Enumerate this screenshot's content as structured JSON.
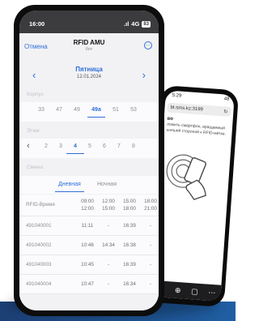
{
  "status_bar": {
    "time": "16:00",
    "network": "4G",
    "battery": "83"
  },
  "back_phone": {
    "time": "5:29",
    "battery": "48",
    "url": "bt.sms.kz:3199",
    "heading": "во",
    "text_lines": [
      "ложить смартфон, вращаемый",
      "ьняшей стороной к RFID-метке."
    ],
    "nav_icons": [
      "arrow-left-icon",
      "plus-icon",
      "tabs-icon",
      "more-icon"
    ]
  },
  "nav": {
    "cancel_label": "Отмена",
    "title": "RFID AMU",
    "subtitle": "бот",
    "more_icon": "ellipsis-circle-icon"
  },
  "day": {
    "name": "Пятница",
    "date": "12.01.2024"
  },
  "building": {
    "label": "Корпус",
    "options": [
      "33",
      "47",
      "49",
      "49a",
      "51",
      "53"
    ],
    "selected": "49a"
  },
  "floor": {
    "label": "Этаж",
    "options": [
      "2",
      "3",
      "4",
      "5",
      "6",
      "7",
      "8"
    ],
    "selected": "4"
  },
  "shift": {
    "label": "Смена",
    "tabs": [
      "Дневная",
      "Ночная"
    ],
    "selected": "Дневная"
  },
  "table": {
    "header_label": "RFID-Время",
    "columns": [
      {
        "start": "09:00",
        "end": "12:00"
      },
      {
        "start": "12:00",
        "end": "15:00"
      },
      {
        "start": "15:00",
        "end": "18:00"
      },
      {
        "start": "18:00",
        "end": "21:00"
      }
    ],
    "rows": [
      {
        "id": "491040001",
        "values": [
          "11:11",
          "-",
          "16:39",
          "-"
        ]
      },
      {
        "id": "491040002",
        "values": [
          "10:46",
          "14:34",
          "16:38",
          "-"
        ]
      },
      {
        "id": "491040003",
        "values": [
          "10:45",
          "-",
          "16:39",
          "-"
        ]
      },
      {
        "id": "491040004",
        "values": [
          "10:47",
          "-",
          "16:34",
          "-"
        ]
      }
    ]
  },
  "colors": {
    "accent": "#2f6fd8",
    "muted": "#8e8e93",
    "phone_frame": "#0d0d0d"
  }
}
